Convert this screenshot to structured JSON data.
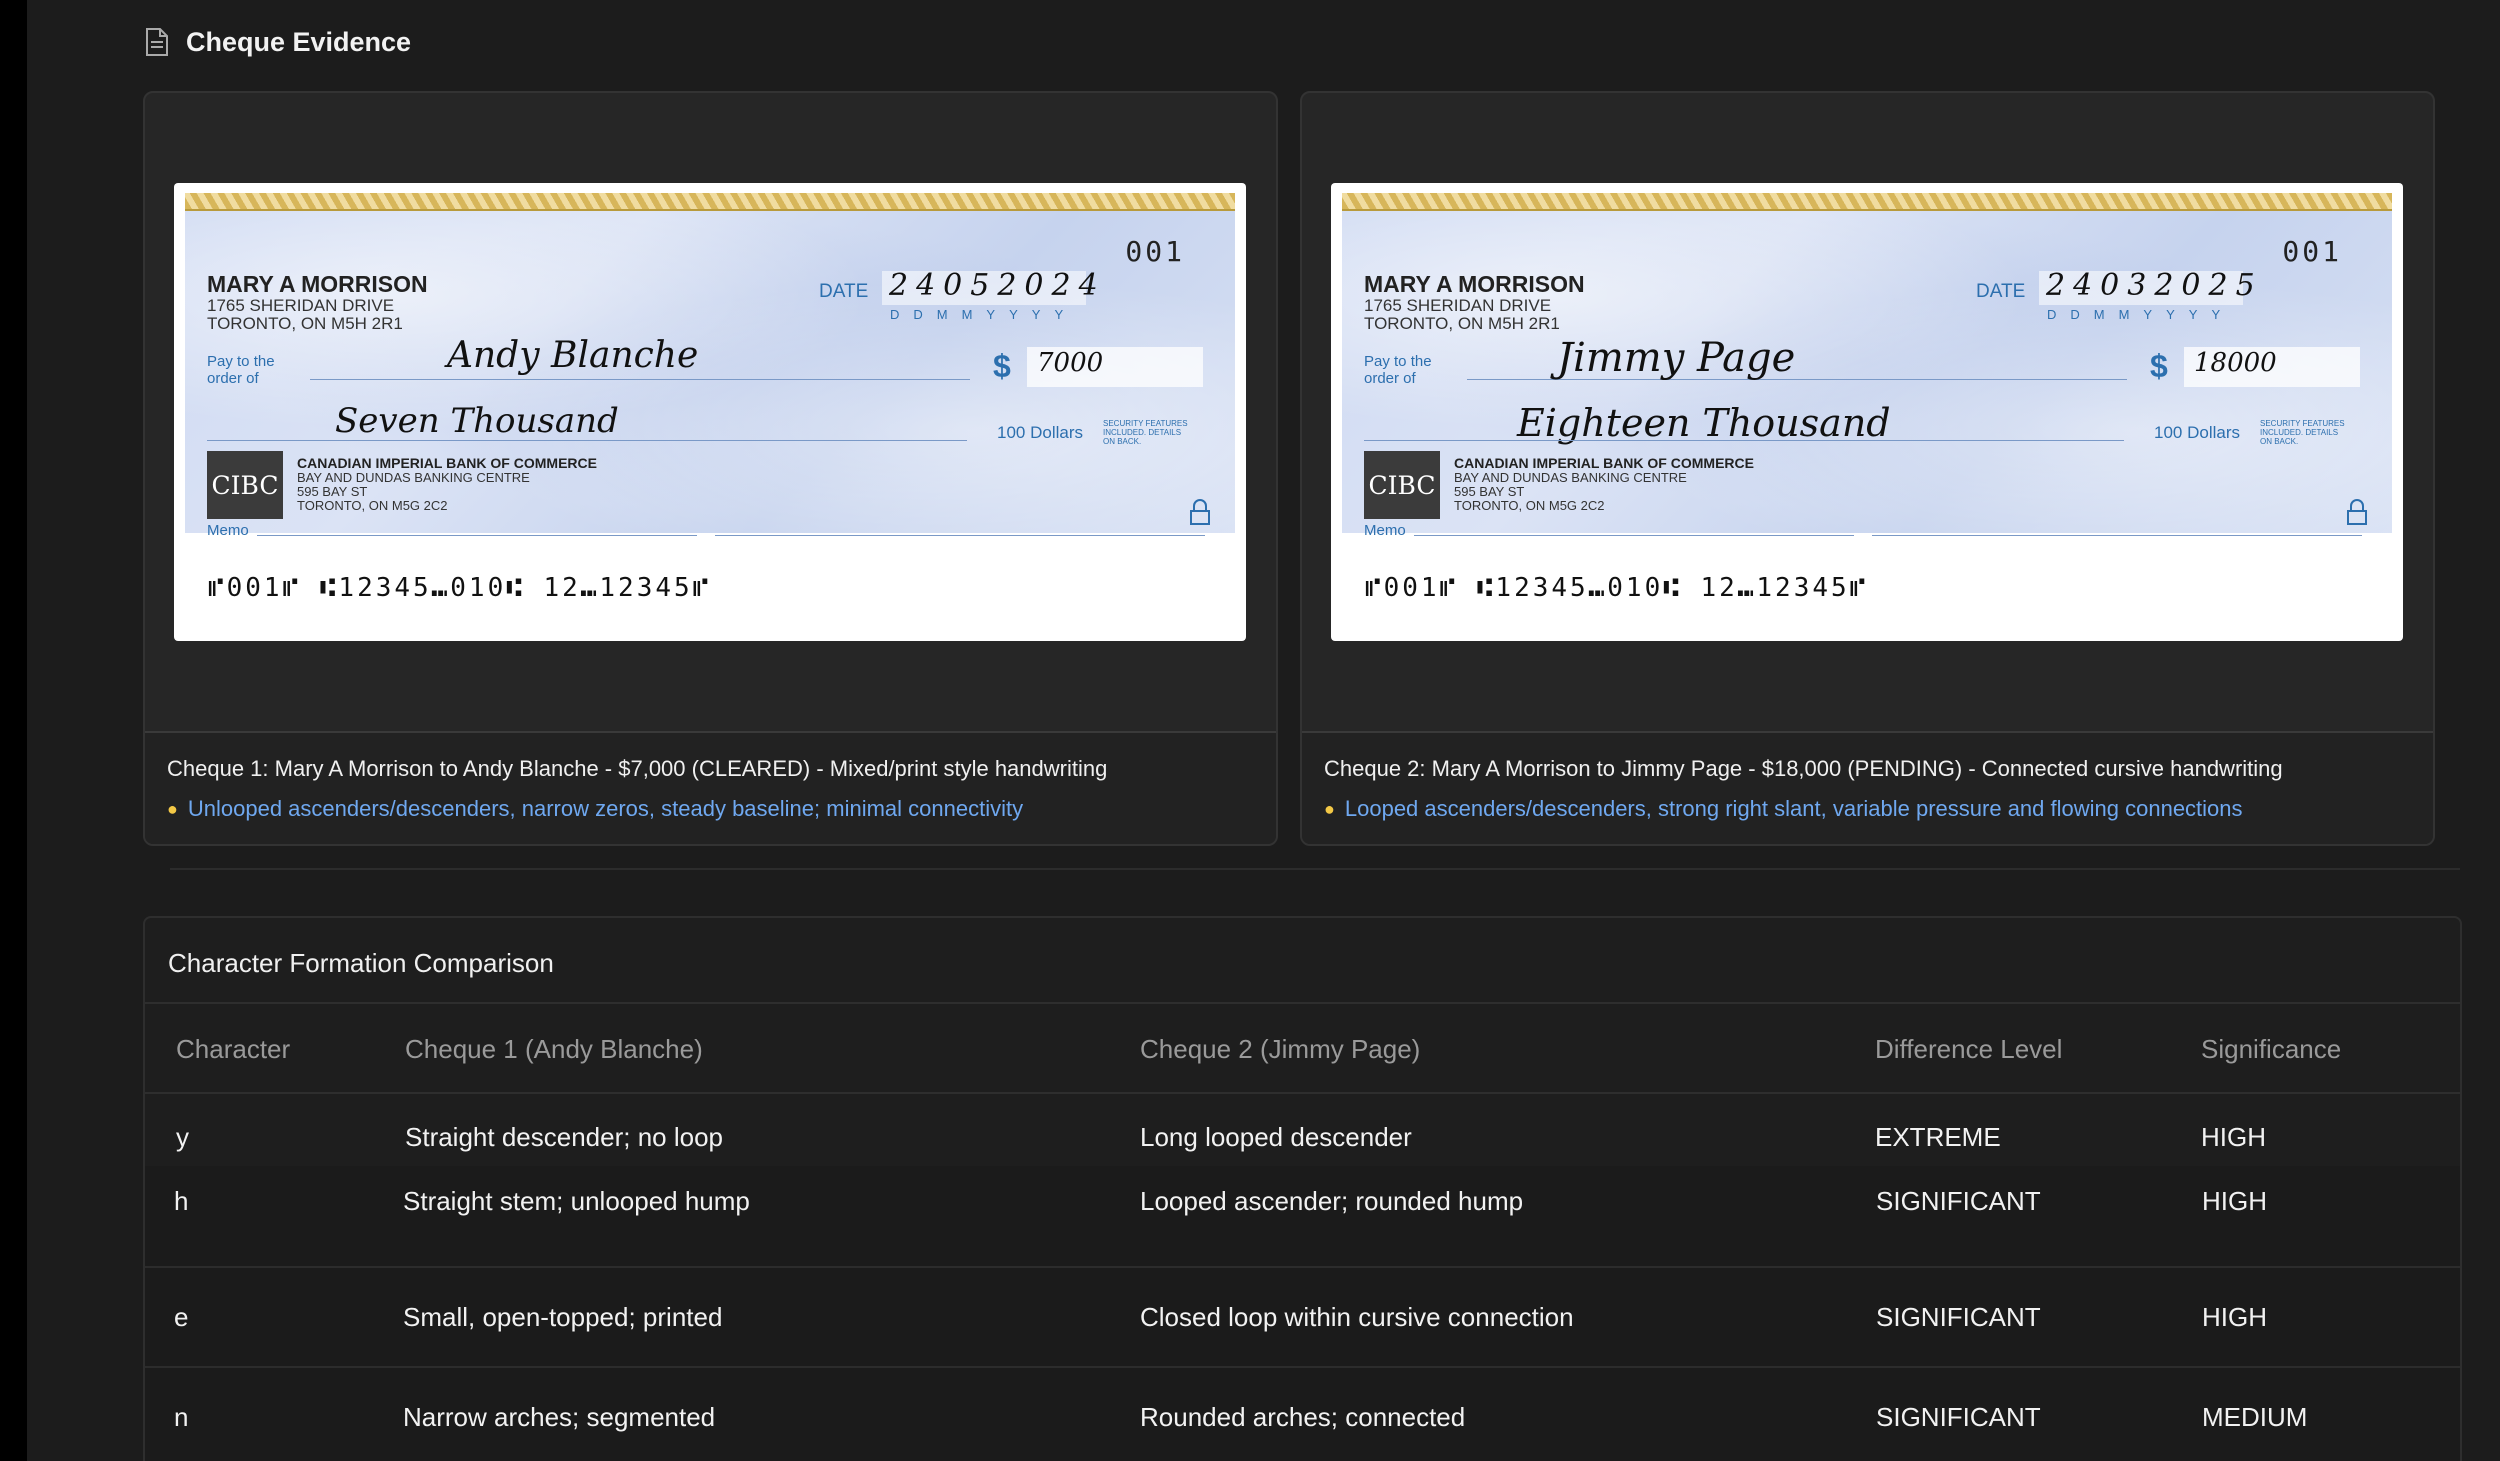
{
  "section": {
    "title": "Cheque Evidence",
    "icon": "document-icon"
  },
  "cheques": [
    {
      "number": "001",
      "payer_name": "MARY A MORRISON",
      "payer_address": [
        "1765 SHERIDAN DRIVE",
        "TORONTO, ON M5H 2R1"
      ],
      "date_label": "DATE",
      "date_value": "24052024",
      "date_hint": "DDMMYYYY",
      "pay_label": [
        "Pay to the",
        "order of"
      ],
      "payee": "Andy Blanche",
      "amount": "7000",
      "amount_words": "Seven Thousand",
      "dollars_label": "100 Dollars",
      "security_text": "SECURITY FEATURES INCLUDED. DETAILS ON BACK.",
      "bank_logo": "CIBC",
      "bank_name": "CANADIAN IMPERIAL BANK OF COMMERCE",
      "bank_address": [
        "BAY AND DUNDAS BANKING CENTRE",
        "595 BAY ST",
        "TORONTO, ON  M5G 2C2"
      ],
      "memo_label": "Memo",
      "micr": "⑈001⑈ ⑆12345⑉010⑆ 12⑉12345⑈",
      "caption_title": "Cheque 1: Mary A Morrison to Andy Blanche - $7,000 (CLEARED) - Mixed/print style handwriting",
      "caption_note": "Unlooped ascenders/descenders, narrow zeros, steady baseline; minimal connectivity"
    },
    {
      "number": "001",
      "payer_name": "MARY A MORRISON",
      "payer_address": [
        "1765 SHERIDAN DRIVE",
        "TORONTO, ON M5H 2R1"
      ],
      "date_label": "DATE",
      "date_value": "24032025",
      "date_hint": "DDMMYYYY",
      "pay_label": [
        "Pay to the",
        "order of"
      ],
      "payee": "Jimmy Page",
      "amount": "18000",
      "amount_words": "Eighteen Thousand",
      "dollars_label": "100 Dollars",
      "security_text": "SECURITY FEATURES INCLUDED. DETAILS ON BACK.",
      "bank_logo": "CIBC",
      "bank_name": "CANADIAN IMPERIAL BANK OF COMMERCE",
      "bank_address": [
        "BAY AND DUNDAS BANKING CENTRE",
        "595 BAY ST",
        "TORONTO, ON  M5G 2C2"
      ],
      "memo_label": "Memo",
      "micr": "⑈001⑈ ⑆12345⑉010⑆ 12⑉12345⑈",
      "caption_title": "Cheque 2: Mary A Morrison to Jimmy Page - $18,000 (PENDING) - Connected cursive handwriting",
      "caption_note": "Looped ascenders/descenders, strong right slant, variable pressure and flowing connections"
    }
  ],
  "comparison": {
    "title": "Character Formation Comparison",
    "headers": [
      "Character",
      "Cheque 1 (Andy Blanche)",
      "Cheque 2 (Jimmy Page)",
      "Difference Level",
      "Significance"
    ],
    "rows": [
      [
        "y",
        "Straight descender; no loop",
        "Long looped descender",
        "EXTREME",
        "HIGH"
      ],
      [
        "h",
        "Straight stem; unlooped hump",
        "Looped ascender; rounded hump",
        "SIGNIFICANT",
        "HIGH"
      ],
      [
        "e",
        "Small, open-topped; printed",
        "Closed loop within cursive connection",
        "SIGNIFICANT",
        "HIGH"
      ],
      [
        "n",
        "Narrow arches; segmented",
        "Rounded arches; connected",
        "SIGNIFICANT",
        "MEDIUM"
      ]
    ]
  }
}
